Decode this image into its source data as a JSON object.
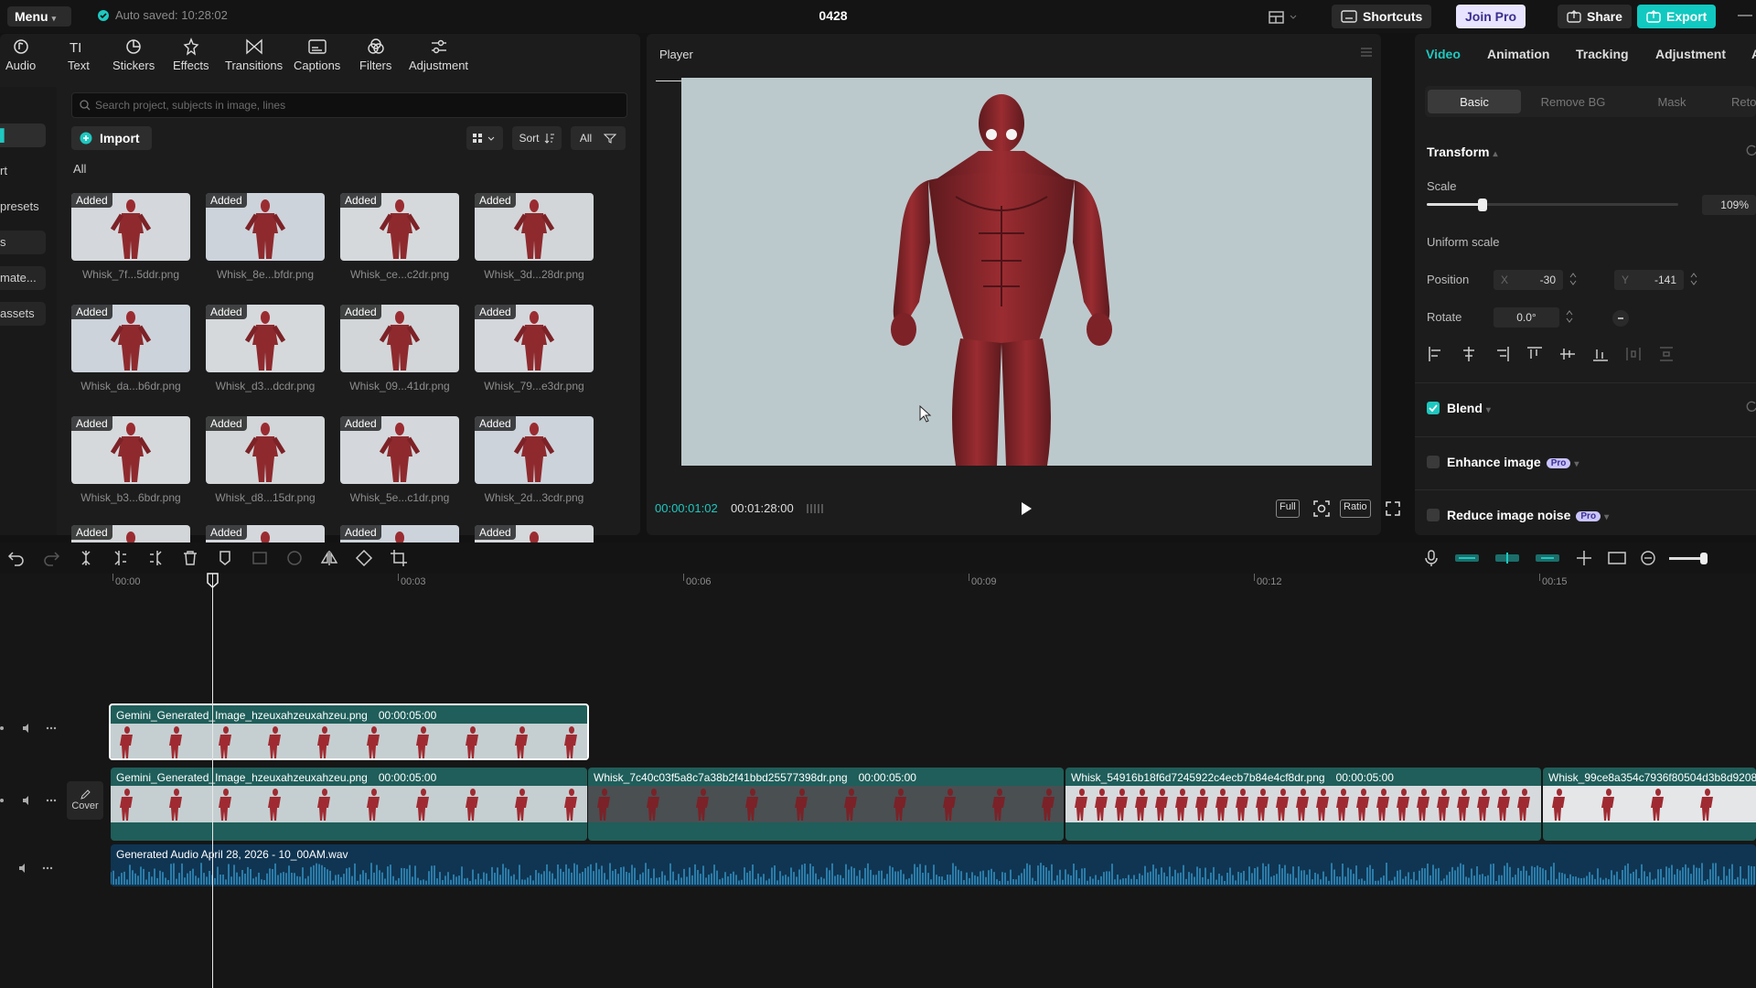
{
  "titlebar": {
    "menu": "Menu",
    "autosave": "Auto saved: 10:28:02",
    "project_title": "0428",
    "shortcuts": "Shortcuts",
    "join_pro": "Join Pro",
    "share": "Share",
    "export": "Export"
  },
  "toolbar": {
    "tabs": [
      {
        "label": "Audio",
        "icon": "audio-icon"
      },
      {
        "label": "Text",
        "icon": "text-icon"
      },
      {
        "label": "Stickers",
        "icon": "stickers-icon"
      },
      {
        "label": "Effects",
        "icon": "effects-icon"
      },
      {
        "label": "Transitions",
        "icon": "transitions-icon"
      },
      {
        "label": "Captions",
        "icon": "captions-icon"
      },
      {
        "label": "Filters",
        "icon": "filters-icon"
      },
      {
        "label": "Adjustment",
        "icon": "adjustment-icon"
      }
    ]
  },
  "sidebar": {
    "items": [
      "",
      "rt",
      "presets",
      "s",
      "mate...",
      "assets"
    ]
  },
  "media": {
    "search_placeholder": "Search project, subjects in image, lines",
    "import": "Import",
    "sort": "Sort",
    "filter_all": "All",
    "all_label": "All",
    "added_badge": "Added",
    "items": [
      "Whisk_7f...5ddr.png",
      "Whisk_8e...bfdr.png",
      "Whisk_ce...c2dr.png",
      "Whisk_3d...28dr.png",
      "Whisk_da...b6dr.png",
      "Whisk_d3...dcdr.png",
      "Whisk_09...41dr.png",
      "Whisk_79...e3dr.png",
      "Whisk_b3...6bdr.png",
      "Whisk_d8...15dr.png",
      "Whisk_5e...c1dr.png",
      "Whisk_2d...3cdr.png",
      "",
      "",
      "",
      ""
    ]
  },
  "player": {
    "title": "Player",
    "current_time": "00:00:01:02",
    "total_time": "00:01:28:00",
    "full": "Full",
    "ratio": "Ratio"
  },
  "inspector": {
    "tabs": [
      "Video",
      "Animation",
      "Tracking",
      "Adjustment",
      "A"
    ],
    "subtabs": [
      "Basic",
      "Remove BG",
      "Mask",
      "Reto"
    ],
    "transform": "Transform",
    "scale_label": "Scale",
    "scale_value": "109%",
    "scale_fraction": 0.22,
    "uniform_scale": "Uniform scale",
    "position_label": "Position",
    "pos_x_label": "X",
    "pos_x": "-30",
    "pos_y_label": "Y",
    "pos_y": "-141",
    "rotate_label": "Rotate",
    "rotate_value": "0.0°",
    "blend": "Blend",
    "enhance_image": "Enhance image",
    "reduce_noise": "Reduce image noise",
    "pro": "Pro",
    "accent_color": "#1ec8c0"
  },
  "timeline": {
    "ruler": [
      "00:00",
      "00:03",
      "00:06",
      "00:09",
      "00:12",
      "00:15"
    ],
    "cover": "Cover",
    "clips": [
      {
        "name": "Gemini_Generated_Image_hzeuxahzeuxahzeu.png",
        "duration": "00:00:05:00"
      },
      {
        "name": "Gemini_Generated_Image_hzeuxahzeuxahzeu.png",
        "duration": "00:00:05:00"
      },
      {
        "name": "Whisk_7c40c03f5a8c7a38b2f41bbd25577398dr.png",
        "duration": "00:00:05:00"
      },
      {
        "name": "Whisk_54916b18f6d7245922c4ecb7b84e4cf8dr.png",
        "duration": "00:00:05:00"
      },
      {
        "name": "Whisk_99ce8a354c7936f80504d3b8d9208",
        "duration": ""
      }
    ],
    "audio_clip": "Generated Audio April 28, 2026 - 10_00AM.wav"
  }
}
